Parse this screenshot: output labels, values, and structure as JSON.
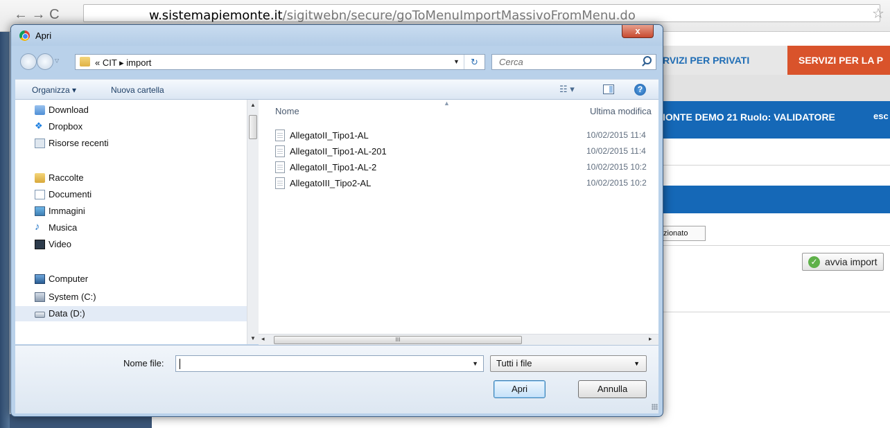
{
  "browser": {
    "url_domain": "w.sistemapiemonte.it",
    "url_path": "/sigitwebn/secure/goToMenuImportMassivoFromMenu.do"
  },
  "site": {
    "tab_privati": "RVIZI PER PRIVATI",
    "tab_pa": "SERVIZI PER LA P",
    "user_bar_text": "IONTE DEMO 21 Ruolo: VALIDATORE",
    "exit_text": "esc",
    "file_chosen_text": "zionato",
    "avvia_import_label": "avvia import",
    "tab_pa_color": "#d9532b",
    "brand_blue": "#1568b7"
  },
  "dialog": {
    "title": "Apri",
    "close_label": "x",
    "path_breadcrumb": "« CIT ▸ import",
    "search_placeholder": "Cerca",
    "toolbar": {
      "organize_label": "Organizza ▾",
      "new_folder_label": "Nuova cartella"
    },
    "nav": {
      "items": [
        {
          "label": "Download",
          "icon": "download-folder-icon"
        },
        {
          "label": "Dropbox",
          "icon": "dropbox-icon"
        },
        {
          "label": "Risorse recenti",
          "icon": "recent-places-icon"
        },
        {
          "label": "Raccolte",
          "icon": "libraries-icon"
        },
        {
          "label": "Documenti",
          "icon": "documents-icon"
        },
        {
          "label": "Immagini",
          "icon": "pictures-icon"
        },
        {
          "label": "Musica",
          "icon": "music-icon"
        },
        {
          "label": "Video",
          "icon": "video-icon"
        },
        {
          "label": "Computer",
          "icon": "computer-icon"
        },
        {
          "label": "System (C:)",
          "icon": "drive-c-icon"
        },
        {
          "label": "Data (D:)",
          "icon": "drive-d-icon",
          "selected": true
        }
      ]
    },
    "files": {
      "columns": {
        "name": "Nome",
        "date": "Ultima modifica"
      },
      "rows": [
        {
          "name": "AllegatoII_Tipo1-AL",
          "date": "10/02/2015 11:4"
        },
        {
          "name": "AllegatoII_Tipo1-AL-201",
          "date": "10/02/2015 11:4"
        },
        {
          "name": "AllegatoII_Tipo1-AL-2",
          "date": "10/02/2015 10:2"
        },
        {
          "name": "AllegatoIII_Tipo2-AL",
          "date": "10/02/2015 10:2"
        }
      ]
    },
    "bottom": {
      "filename_label": "Nome file:",
      "filename_value": "",
      "filetype_value": "Tutti i file",
      "open_label": "Apri",
      "cancel_label": "Annulla"
    },
    "hscroll_thumb_glyph": "III"
  }
}
